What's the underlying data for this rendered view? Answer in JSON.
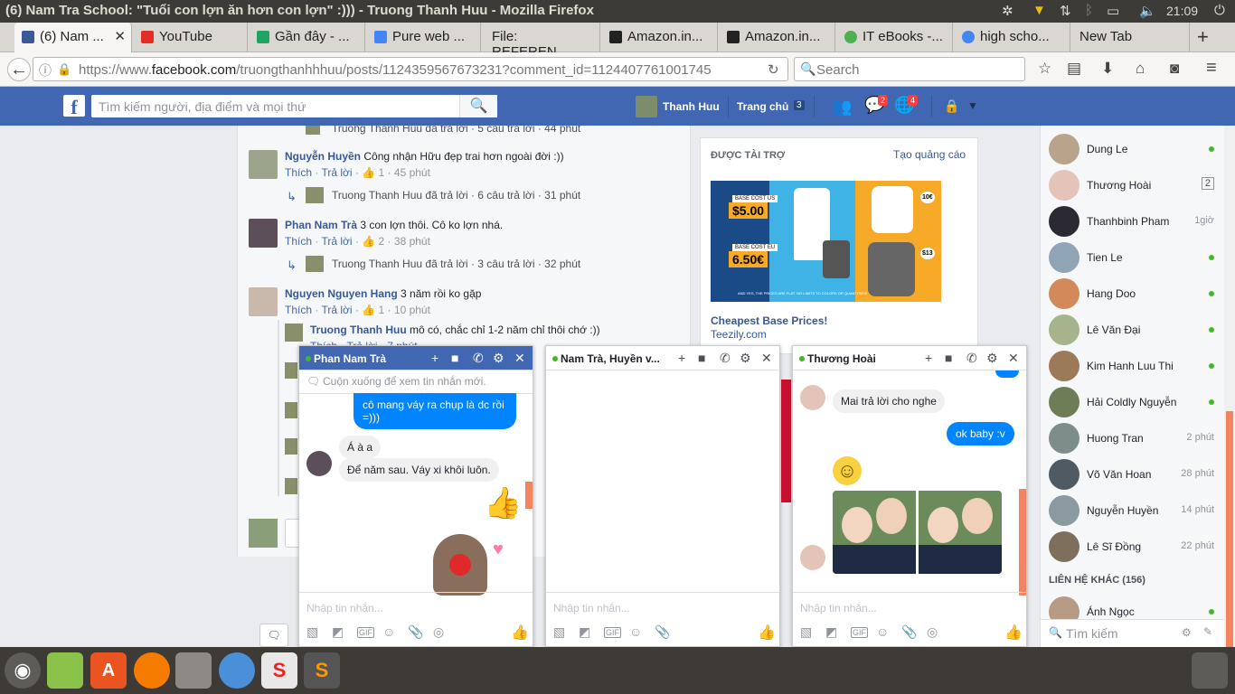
{
  "os": {
    "window_title": "(6) Nam Tra School: \"Tuổi con lợn ăn hơn con lợn\" :))) - Truong Thanh Huu - Mozilla Firefox",
    "clock": "21:09"
  },
  "browser": {
    "tabs": [
      {
        "label": "(6) Nam ...",
        "color": "#3b5998"
      },
      {
        "label": "YouTube",
        "color": "#e52d27"
      },
      {
        "label": "Gần đây - ...",
        "color": "#1fa463"
      },
      {
        "label": "Pure web ...",
        "color": "#4285f4"
      },
      {
        "label": "File: REFEREN...",
        "color": "#dad7d3"
      },
      {
        "label": "Amazon.in...",
        "color": "#222222"
      },
      {
        "label": "Amazon.in...",
        "color": "#222222"
      },
      {
        "label": "IT eBooks -...",
        "color": "#4caf50"
      },
      {
        "label": "high scho...",
        "color": "#4285f4"
      },
      {
        "label": "New Tab",
        "color": "#dad7d3"
      }
    ],
    "url_prefix": "https://www.",
    "url_domain": "facebook.com",
    "url_path": "/truongthanhhhuu/posts/1124359567673231?comment_id=1124407761001745",
    "search_placeholder": "Search"
  },
  "fb": {
    "search_placeholder": "Tìm kiếm người, địa điểm và mọi thứ",
    "user_name": "Thanh Huu",
    "home_label": "Trang chủ",
    "home_count": "3",
    "messages_badge": "2",
    "notifications_badge": "4",
    "comments": [
      {
        "name": "Nguyễn Huyền",
        "text": "Công nhận Hữu đẹp trai hơn ngoài đời :))",
        "like": "Thích",
        "reply": "Trả lời",
        "likes": "1",
        "time": "45 phút",
        "replies_text": "Truong Thanh Huu đã trả lời · 6 câu trả lời · 31 phút"
      },
      {
        "name": "Phan Nam Trà",
        "text": "3 con lợn thôi. Cô ko lợn nhá.",
        "like": "Thích",
        "reply": "Trả lời",
        "likes": "2",
        "time": "38 phút",
        "replies_text": "Truong Thanh Huu đã trả lời · 3 câu trả lời · 32 phút"
      },
      {
        "name": "Nguyen Nguyen Hang",
        "text": "3 năm rồi ko gặp",
        "like": "Thích",
        "reply": "Trả lời",
        "likes": "1",
        "time": "10 phút"
      }
    ],
    "top_reply": "Truong Thanh Huu đã trả lời · 5 câu trả lời · 44 phút",
    "nested_reply": {
      "name": "Truong Thanh Huu",
      "text": "mô có, chắc chỉ 1-2 năm chỉ thôi chớ :))",
      "meta": "Thích · Trả lời · 7 phút"
    },
    "ad": {
      "header": "ĐƯỢC TÀI TRỢ",
      "create": "Tạo quảng cáo",
      "title": "Cheapest Base Prices!",
      "domain": "Teezily.com",
      "price_us_label": "BASE COST US",
      "price_us": "$5.00",
      "price_eu_label": "BASE COST EU",
      "price_eu": "6.50€",
      "price_10": "10€",
      "price_13": "$13",
      "footer": "AND YES, THE PRICES ARE FLAT. NO LIMITS TO COLORS OR QUANTITIES!"
    }
  },
  "chats": [
    {
      "title": "Phan Nam Trà",
      "notice": "Cuộn xuống để xem tin nhắn mới.",
      "messages": [
        {
          "dir": "out",
          "text": "cô mang váy ra chụp là dc rồi =)))"
        },
        {
          "dir": "in",
          "text": "Á à a"
        },
        {
          "dir": "in",
          "text": "Để năm sau. Váy xi khôi luôn."
        }
      ],
      "placeholder": "Nhập tin nhắn..."
    },
    {
      "title": "Nam Trà, Huyền v...",
      "placeholder": "Nhập tin nhắn..."
    },
    {
      "title": "Thương Hoài",
      "messages": [
        {
          "dir": "in",
          "text": "Mai trả lời cho nghe"
        },
        {
          "dir": "out",
          "text": "ok baby :v"
        }
      ],
      "placeholder": "Nhập tin nhắn..."
    }
  ],
  "sidebar": {
    "contacts": [
      {
        "name": "Dung Le",
        "status": "",
        "online": true,
        "color": "#b8a48a"
      },
      {
        "name": "Thương Hoài",
        "status": "2",
        "online": false,
        "color": "#e4c3b8"
      },
      {
        "name": "Thanhbinh Pham",
        "status": "1giờ",
        "online": false,
        "color": "#2b2a33"
      },
      {
        "name": "Tien Le",
        "status": "",
        "online": true,
        "color": "#8fa4b5"
      },
      {
        "name": "Hang Doo",
        "status": "",
        "online": true,
        "color": "#d28a5a"
      },
      {
        "name": "Lê Văn Đại",
        "status": "",
        "online": true,
        "color": "#a7b38a"
      },
      {
        "name": "Kim Hanh Luu Thi",
        "status": "",
        "online": true,
        "color": "#9b7a58"
      },
      {
        "name": "Hải Coldly Nguyễn",
        "status": "",
        "online": true,
        "color": "#6f7d57"
      },
      {
        "name": "Huong Tran",
        "status": "2 phút",
        "online": false,
        "color": "#7d8d8a"
      },
      {
        "name": "Võ Văn Hoan",
        "status": "28 phút",
        "online": false,
        "color": "#4f5a63"
      },
      {
        "name": "Nguyễn Huyền",
        "status": "14 phút",
        "online": false,
        "color": "#8a9aa0"
      },
      {
        "name": "Lê Sĩ Đồng",
        "status": "22 phút",
        "online": false,
        "color": "#7e6f5d"
      }
    ],
    "more_label": "LIÊN HỆ KHÁC (156)",
    "more_contacts": [
      {
        "name": "Ánh Ngọc",
        "online": true,
        "color": "#b79a83"
      }
    ],
    "search_placeholder": "Tìm kiếm"
  }
}
